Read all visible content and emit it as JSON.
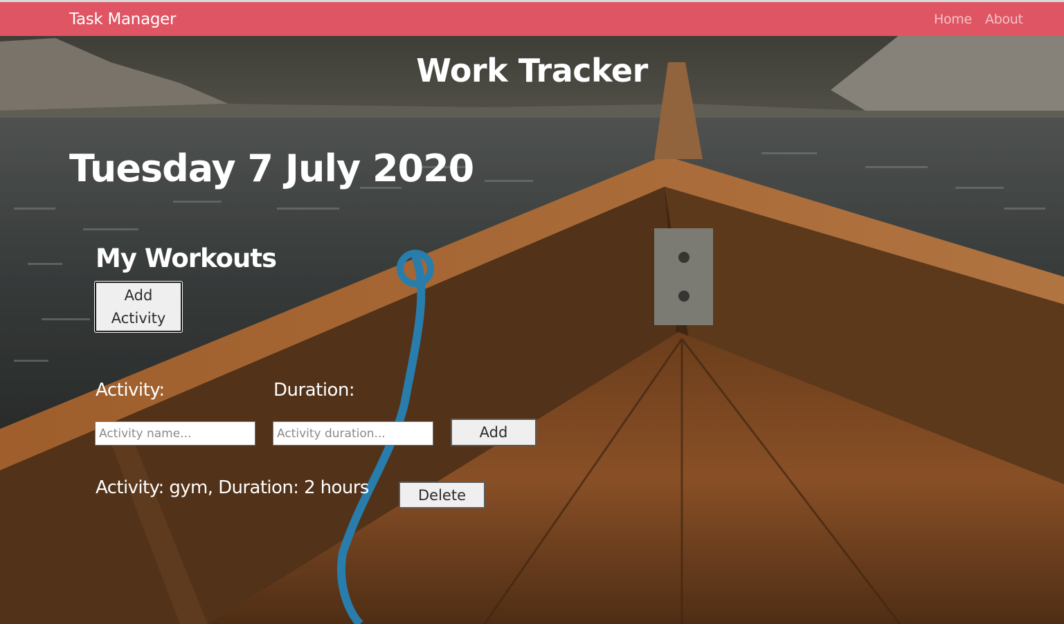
{
  "navbar": {
    "brand": "Task Manager",
    "links": [
      "Home",
      "About"
    ],
    "color": "#e05563"
  },
  "main": {
    "title": "Work Tracker",
    "date": "Tuesday 7 July 2020",
    "section_title": "My Workouts",
    "add_activity_button": "Add Activity",
    "form": {
      "activity_label": "Activity:",
      "activity_placeholder": "Activity name...",
      "duration_label": "Duration:",
      "duration_placeholder": "Activity duration...",
      "add_button": "Add"
    },
    "entries": [
      {
        "text": "Activity: gym, Duration: 2 hours",
        "delete_label": "Delete"
      }
    ]
  },
  "background": {
    "description_icon": "rowboat-lake-photo"
  }
}
